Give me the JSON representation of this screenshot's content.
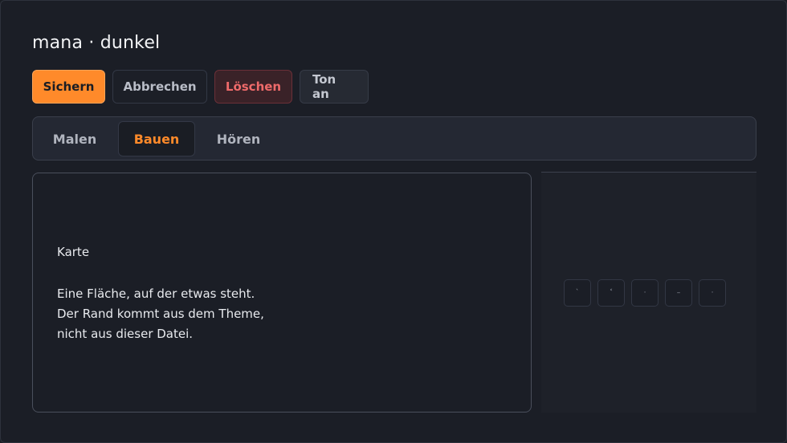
{
  "title": "mana · dunkel",
  "toolbar": {
    "save_label": "Sichern",
    "cancel_label": "Abbrechen",
    "delete_label": "Löschen",
    "sound_label": "Ton an"
  },
  "tabs": [
    {
      "label": "Malen",
      "active": false
    },
    {
      "label": "Bauen",
      "active": true
    },
    {
      "label": "Hören",
      "active": false
    }
  ],
  "card": {
    "title": "Karte",
    "body": "Eine Fläche, auf der etwas steht.\nDer Rand kommt aus dem Theme,\nnicht aus dieser Datei."
  },
  "side_panel": {
    "icons": [
      {
        "name": "slash-icon",
        "glyph": "ˋ"
      },
      {
        "name": "angle-icon",
        "glyph": "˂"
      },
      {
        "name": "dot-icon",
        "glyph": "·"
      },
      {
        "name": "dash-icon",
        "glyph": "–"
      },
      {
        "name": "point-icon",
        "glyph": "·"
      }
    ]
  },
  "colors": {
    "accent": "#ff8a2a",
    "danger": "#ee6a6a",
    "background": "#1b1e26"
  }
}
